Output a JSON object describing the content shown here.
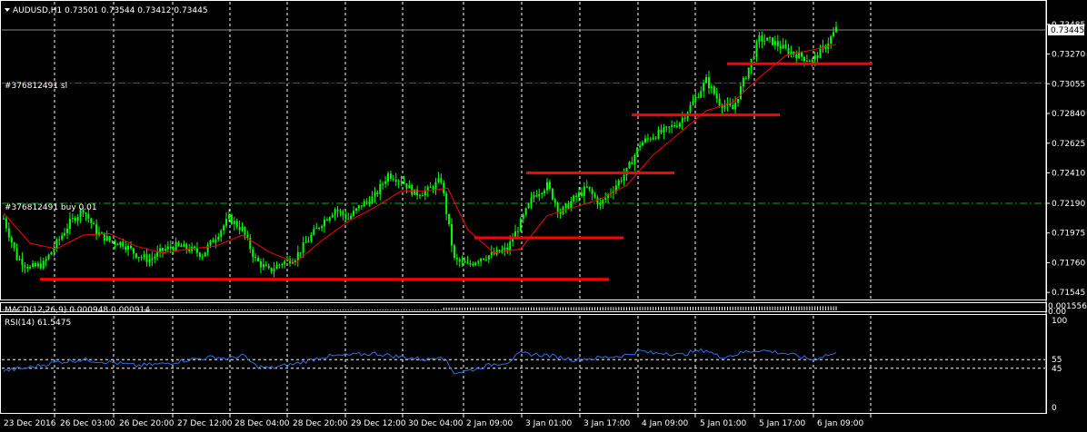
{
  "symbol_header": {
    "text": "AUDUSD,H1  0.73501 0.73544 0.73412 0.73445"
  },
  "colors": {
    "background": "#000000",
    "candle": "#00ff00",
    "ma": "#ff0000",
    "sl_line": "#ff0000",
    "buy_line": "#00b000",
    "level_lines": "#ff0000",
    "rsi_line": "#2f6fe8",
    "grid": "#ffffff",
    "macd_hist": "#ffffff"
  },
  "chart_data": [
    {
      "type": "candlestick",
      "title": "AUDUSD,H1",
      "ylim": [
        0.7152,
        0.7353
      ],
      "y_ticks": [
        "0.73485",
        "0.73270",
        "0.73055",
        "0.72840",
        "0.72625",
        "0.72410",
        "0.72190",
        "0.71975",
        "0.71760",
        "0.71545"
      ],
      "current_price": "0.73445",
      "x_ticks": [
        "23 Dec 2016",
        "26 Dec 03:00",
        "26 Dec 20:00",
        "27 Dec 12:00",
        "28 Dec 04:00",
        "28 Dec 20:00",
        "29 Dec 12:00",
        "30 Dec 04:00",
        "2 Jan 09:00",
        "3 Jan 01:00",
        "3 Jan 17:00",
        "4 Jan 09:00",
        "5 Jan 01:00",
        "5 Jan 17:00",
        "6 Jan 09:00"
      ],
      "trade_lines": [
        {
          "label": "#376812491 sl",
          "price": 0.7306
        },
        {
          "label": "#376812491 buy 0.01",
          "price": 0.7219
        }
      ],
      "support_resistance_levels": [
        {
          "price": 0.7164,
          "from": "23 Dec 2016",
          "to": "3 Jan 17:00"
        },
        {
          "price": 0.7194,
          "from": "2 Jan 09:00",
          "to": "3 Jan 17:00"
        },
        {
          "price": 0.7241,
          "from": "3 Jan 01:00",
          "to": "4 Jan 09:00"
        },
        {
          "price": 0.7283,
          "from": "4 Jan 09:00",
          "to": "5 Jan 17:00"
        },
        {
          "price": 0.732,
          "from": "5 Jan 01:00",
          "to": "6 Jan 09:00"
        }
      ],
      "close_path": [
        [
          0,
          0.7208
        ],
        [
          10,
          0.718
        ],
        [
          20,
          0.7172
        ],
        [
          30,
          0.7175
        ],
        [
          40,
          0.719
        ],
        [
          50,
          0.7205
        ],
        [
          60,
          0.7215
        ],
        [
          70,
          0.7198
        ],
        [
          80,
          0.7192
        ],
        [
          90,
          0.719
        ],
        [
          100,
          0.7182
        ],
        [
          110,
          0.7178
        ],
        [
          120,
          0.7185
        ],
        [
          130,
          0.7188
        ],
        [
          140,
          0.7186
        ],
        [
          150,
          0.7182
        ],
        [
          160,
          0.7195
        ],
        [
          170,
          0.7208
        ],
        [
          180,
          0.72
        ],
        [
          190,
          0.7178
        ],
        [
          200,
          0.717
        ],
        [
          210,
          0.7176
        ],
        [
          220,
          0.718
        ],
        [
          230,
          0.7193
        ],
        [
          240,
          0.7205
        ],
        [
          250,
          0.7215
        ],
        [
          260,
          0.7208
        ],
        [
          270,
          0.7218
        ],
        [
          280,
          0.7224
        ],
        [
          290,
          0.724
        ],
        [
          300,
          0.7236
        ],
        [
          310,
          0.7226
        ],
        [
          320,
          0.7228
        ],
        [
          330,
          0.7236
        ],
        [
          340,
          0.7178
        ],
        [
          350,
          0.7174
        ],
        [
          360,
          0.718
        ],
        [
          370,
          0.7182
        ],
        [
          380,
          0.7186
        ],
        [
          390,
          0.7205
        ],
        [
          400,
          0.7225
        ],
        [
          410,
          0.7232
        ],
        [
          420,
          0.7212
        ],
        [
          430,
          0.7222
        ],
        [
          440,
          0.723
        ],
        [
          450,
          0.7218
        ],
        [
          460,
          0.723
        ],
        [
          470,
          0.7242
        ],
        [
          480,
          0.7262
        ],
        [
          490,
          0.7268
        ],
        [
          500,
          0.7272
        ],
        [
          510,
          0.7278
        ],
        [
          520,
          0.7292
        ],
        [
          530,
          0.7308
        ],
        [
          540,
          0.7292
        ],
        [
          550,
          0.7287
        ],
        [
          560,
          0.7312
        ],
        [
          570,
          0.7338
        ],
        [
          580,
          0.7336
        ],
        [
          590,
          0.733
        ],
        [
          600,
          0.7326
        ],
        [
          610,
          0.7322
        ],
        [
          620,
          0.7333
        ],
        [
          628,
          0.7345
        ]
      ],
      "ma_path": [
        [
          0,
          0.7212
        ],
        [
          20,
          0.719
        ],
        [
          40,
          0.7186
        ],
        [
          60,
          0.7196
        ],
        [
          80,
          0.7197
        ],
        [
          100,
          0.7188
        ],
        [
          120,
          0.7183
        ],
        [
          140,
          0.7186
        ],
        [
          160,
          0.7188
        ],
        [
          180,
          0.7196
        ],
        [
          200,
          0.7184
        ],
        [
          220,
          0.7176
        ],
        [
          240,
          0.7192
        ],
        [
          260,
          0.7206
        ],
        [
          280,
          0.7216
        ],
        [
          300,
          0.7228
        ],
        [
          320,
          0.7228
        ],
        [
          335,
          0.723
        ],
        [
          350,
          0.72
        ],
        [
          370,
          0.7183
        ],
        [
          390,
          0.7186
        ],
        [
          410,
          0.721
        ],
        [
          430,
          0.7216
        ],
        [
          450,
          0.7222
        ],
        [
          470,
          0.7232
        ],
        [
          490,
          0.7254
        ],
        [
          510,
          0.727
        ],
        [
          530,
          0.7286
        ],
        [
          550,
          0.7292
        ],
        [
          570,
          0.731
        ],
        [
          590,
          0.7326
        ],
        [
          610,
          0.733
        ],
        [
          628,
          0.7334
        ]
      ]
    },
    {
      "type": "histogram",
      "title": "MACD(12,26,9) 0.000948 0.000914",
      "y_ticks": [
        "0.001556",
        "0.00"
      ]
    },
    {
      "type": "line",
      "title": "RSI(14) 61.5475",
      "ylim": [
        0,
        100
      ],
      "y_ticks": [
        "100",
        "55",
        "45",
        "0"
      ],
      "levels": [
        55,
        45
      ],
      "values_path": [
        [
          0,
          42
        ],
        [
          20,
          46
        ],
        [
          40,
          52
        ],
        [
          60,
          55
        ],
        [
          80,
          52
        ],
        [
          100,
          48
        ],
        [
          120,
          50
        ],
        [
          140,
          55
        ],
        [
          160,
          58
        ],
        [
          170,
          56
        ],
        [
          180,
          60
        ],
        [
          190,
          48
        ],
        [
          200,
          45
        ],
        [
          220,
          50
        ],
        [
          240,
          58
        ],
        [
          260,
          60
        ],
        [
          280,
          62
        ],
        [
          300,
          58
        ],
        [
          320,
          55
        ],
        [
          330,
          60
        ],
        [
          340,
          40
        ],
        [
          350,
          42
        ],
        [
          360,
          46
        ],
        [
          370,
          50
        ],
        [
          380,
          52
        ],
        [
          390,
          62
        ],
        [
          410,
          60
        ],
        [
          430,
          55
        ],
        [
          450,
          57
        ],
        [
          470,
          60
        ],
        [
          480,
          65
        ],
        [
          490,
          62
        ],
        [
          500,
          63
        ],
        [
          510,
          60
        ],
        [
          520,
          64
        ],
        [
          530,
          66
        ],
        [
          540,
          58
        ],
        [
          550,
          60
        ],
        [
          560,
          64
        ],
        [
          570,
          66
        ],
        [
          590,
          62
        ],
        [
          610,
          55
        ],
        [
          620,
          60
        ],
        [
          628,
          61.5
        ]
      ]
    }
  ]
}
